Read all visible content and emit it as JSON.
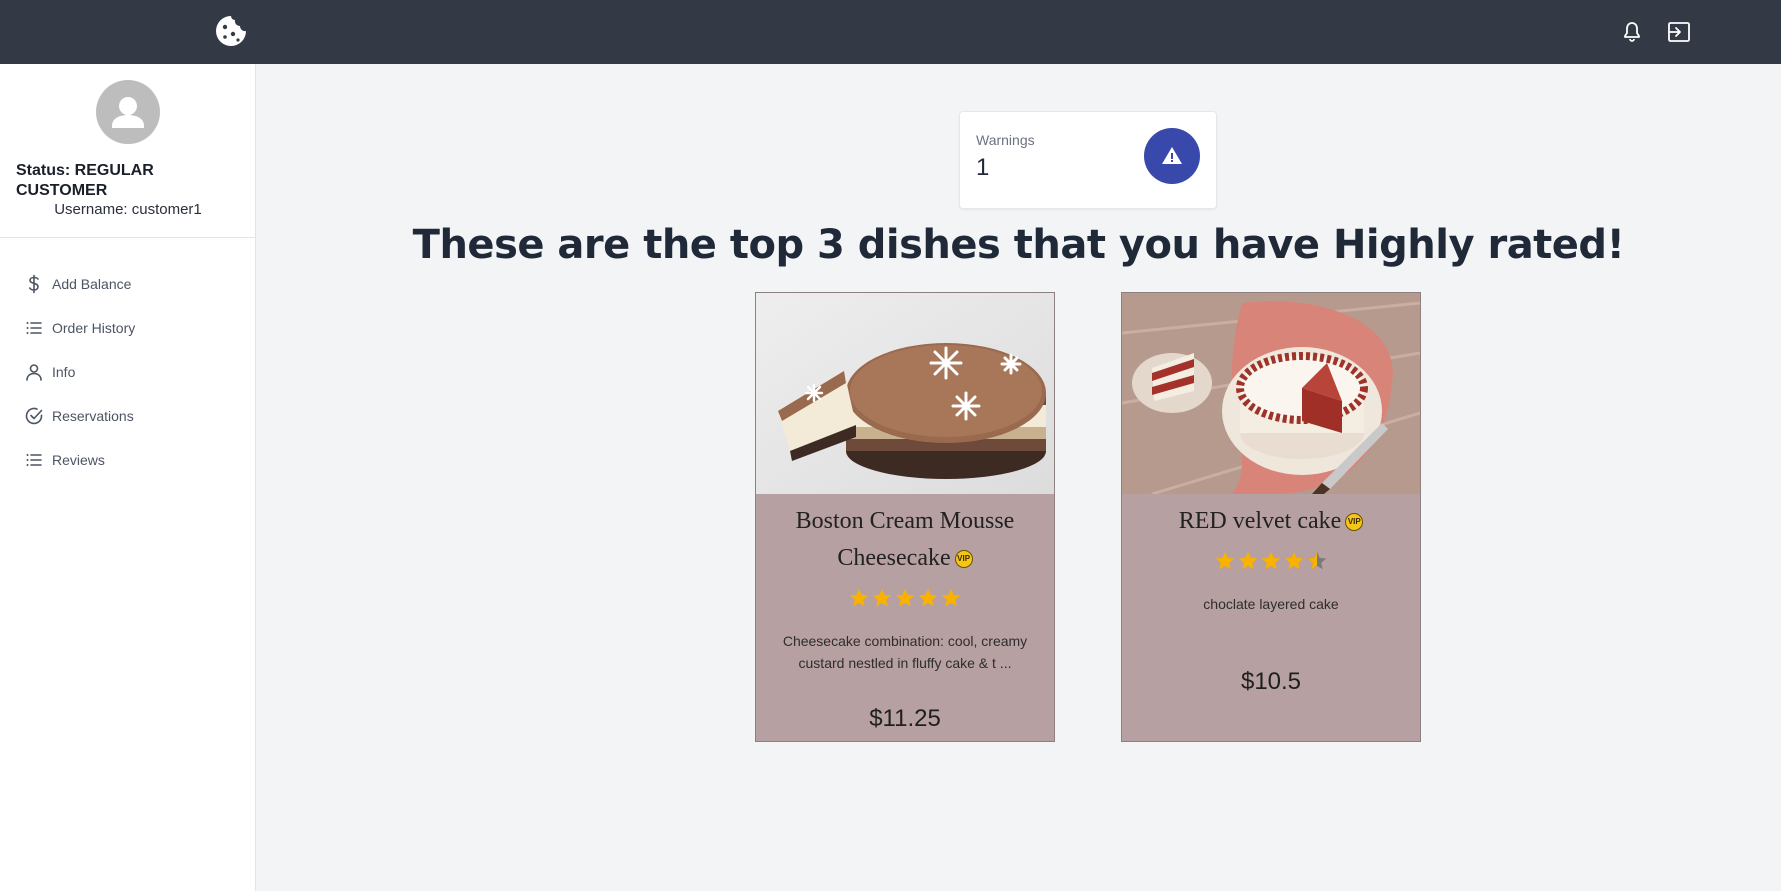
{
  "header": {
    "logo_icon": "cookie-icon",
    "notification_icon": "bell-icon",
    "logout_icon": "logout-icon"
  },
  "sidebar": {
    "avatar_icon": "person-icon",
    "status": "Status: REGULAR CUSTOMER",
    "username": "Username: customer1",
    "items": [
      {
        "label": "Add Balance",
        "icon": "dollar-icon"
      },
      {
        "label": "Order History",
        "icon": "list-icon"
      },
      {
        "label": "Info",
        "icon": "user-icon"
      },
      {
        "label": "Reservations",
        "icon": "check-circle-icon"
      },
      {
        "label": "Reviews",
        "icon": "list-icon"
      }
    ]
  },
  "warnings": {
    "label": "Warnings",
    "value": "1",
    "icon": "warning-icon",
    "icon_bg": "#3949ab"
  },
  "main": {
    "heading": "These are the top 3 dishes that you have Highly rated!"
  },
  "dishes": [
    {
      "name": "Boston Cream Mousse Cheesecake",
      "badge": "VIP",
      "rating": 5,
      "description": "Cheesecake combination: cool, creamy custard nestled in fluffy cake & t ...",
      "price": "$11.25"
    },
    {
      "name": "RED velvet cake",
      "badge": "VIP",
      "rating": 4.5,
      "description": "choclate layered cake",
      "price": "$10.5"
    }
  ],
  "colors": {
    "topbar": "#343a45",
    "card_bg": "#b7a0a2",
    "star": "#f9b200",
    "star_empty": "#7a7a7a"
  }
}
